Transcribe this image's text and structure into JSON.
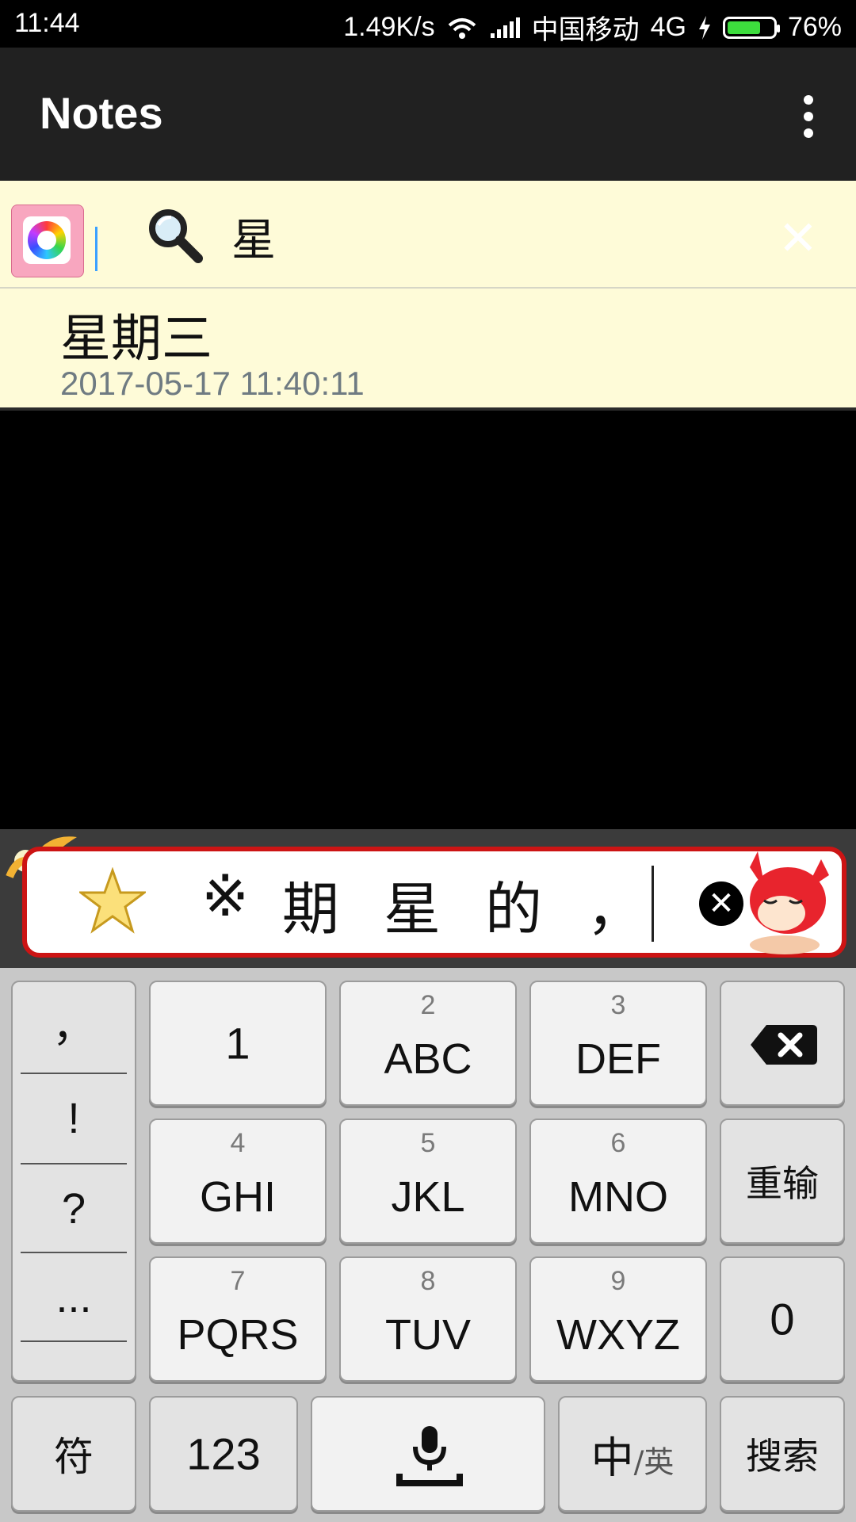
{
  "status_bar": {
    "time": "11:44",
    "network_speed": "1.49K/s",
    "carrier": "中国移动",
    "network_type": "4G",
    "battery_percent": "76%",
    "battery_level": 0.76,
    "icons": [
      "wifi-icon",
      "signal-icon",
      "charging-icon",
      "battery-icon"
    ]
  },
  "app_bar": {
    "title": "Notes",
    "overflow_icon": "more-vert-icon"
  },
  "search": {
    "query": "星",
    "icons": [
      "color-palette-icon",
      "search-icon",
      "clear-icon"
    ]
  },
  "results": [
    {
      "title": "星期三",
      "date": "2017-05-17 11:40:11"
    }
  ],
  "ime": {
    "candidates": [
      "※",
      "期",
      "星",
      "的",
      "，"
    ],
    "icons": [
      "star-icon",
      "close-candidates-icon",
      "fox-mascot-icon"
    ],
    "punctuation": [
      "，",
      "!",
      "?",
      "..."
    ],
    "keys": {
      "k1": "1",
      "k2_num": "2",
      "k2": "ABC",
      "k3_num": "3",
      "k3": "DEF",
      "k4_num": "4",
      "k4": "GHI",
      "k5_num": "5",
      "k5": "JKL",
      "k6_num": "6",
      "k6": "MNO",
      "k7_num": "7",
      "k7": "PQRS",
      "k8_num": "8",
      "k8": "TUV",
      "k9_num": "9",
      "k9": "WXYZ",
      "k0": "0",
      "reinput": "重输",
      "symbols": "符",
      "numbers": "123",
      "lang_main": "中",
      "lang_alt": "/英",
      "search": "搜索"
    }
  }
}
